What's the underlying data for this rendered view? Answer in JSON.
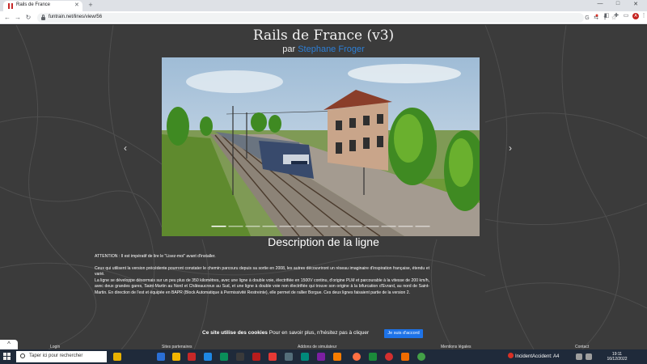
{
  "browser": {
    "tab_title": "Rails de France",
    "new_tab": "+",
    "url": "funtrain.net/lines/view/56",
    "window_controls": {
      "minimize": "—",
      "maximize": "□",
      "close": "✕"
    }
  },
  "page": {
    "title": "Rails de France (v3)",
    "byline_prefix": "par",
    "author": "Stephane Froger",
    "carousel": {
      "prev": "‹",
      "next": "›",
      "indicator_count": 13,
      "active_index": 0
    },
    "description_heading": "Description de la ligne",
    "description": {
      "warning": "ATTENTION : Il est impératif de lire le \"Lisez-moi\" avant d'installer.",
      "paragraph_1": "Ceux qui utilisent la version précédente pourront constater le chemin parcouru depuis sa sortie en 2008, les autres découvriront un réseau imaginaire d'inspiration française, étendu et varié.",
      "paragraph_2": "La ligne se développe désormais sur un peu plus de 350 kilomètres, avec une ligne à double voie, électrifiée en 1500V continu, d'origine PLM et parcourable à la vitesse de 200 km/h, avec deux grandes gares, Saint-Martin au Nord et Châteaucreux au Sud, et une ligne à double voie non électrifiée qui trouve son origine à la bifurcation d'Evrard, au nord de Saint-Martin. En direction de l'est et équipée en BAPR (Block Automatique à Permissivité Restreinte), elle permet de rallier Borgue. Ces deux lignes faisaient partie de la version 2."
    },
    "cookie": {
      "bold": "Ce site utilise des cookies",
      "text": "Pour en savoir plus, n'hésitez pas à cliquer",
      "button": "Je suis d'accord"
    },
    "footer": [
      "Login",
      "Sites partenaires",
      "Addons de simulateur",
      "Mentions légales",
      "Contact"
    ],
    "scroll_top": "^"
  },
  "taskbar": {
    "search_placeholder": "Taper ici pour rechercher",
    "alert_label": "IncidentAccident: A4",
    "time": "19:11",
    "date": "16/12/2022"
  }
}
